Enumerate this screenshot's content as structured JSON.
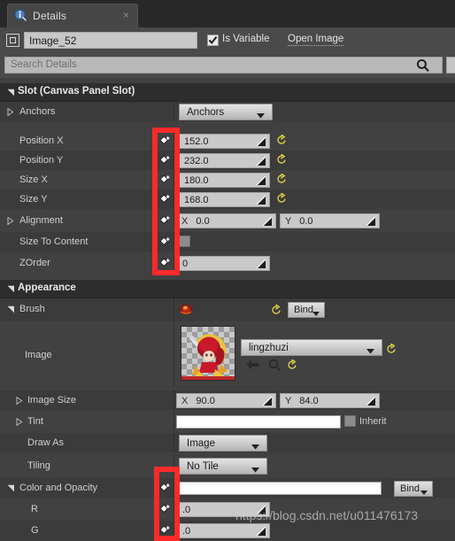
{
  "window": {
    "tab": {
      "label": "Details",
      "icon": "details-info-icon",
      "close_icon": "×"
    }
  },
  "object_row": {
    "icon": "widget-icon",
    "name_value": "Image_52",
    "is_variable_label": "Is Variable",
    "is_variable_checked": true,
    "open_image_link": "Open Image"
  },
  "search": {
    "placeholder": "Search Details",
    "value": "",
    "icon": "search-icon"
  },
  "sections": [
    {
      "title": "Slot (Canvas Panel Slot)",
      "expanded": true,
      "rows": [
        {
          "label": "Anchors",
          "type": "combo",
          "value": "Anchors",
          "expandable": true
        },
        {
          "label": "Position X",
          "type": "num",
          "value": "152.0",
          "reset": true
        },
        {
          "label": "Position Y",
          "type": "num",
          "value": "232.0",
          "reset": true
        },
        {
          "label": "Size X",
          "type": "num",
          "value": "180.0",
          "reset": true
        },
        {
          "label": "Size Y",
          "type": "num",
          "value": "168.0",
          "reset": true
        },
        {
          "label": "Alignment",
          "type": "xy",
          "x_label": "X",
          "x_value": "0.0",
          "y_label": "Y",
          "y_value": "0.0",
          "expandable": true
        },
        {
          "label": "Size To Content",
          "type": "check",
          "checked": false
        },
        {
          "label": "ZOrder",
          "type": "num",
          "value": "0"
        }
      ]
    },
    {
      "title": "Appearance",
      "expanded": true,
      "rows": [
        {
          "label": "Brush",
          "type": "brush-header",
          "bind_label": "Bind",
          "expandable": true
        },
        {
          "label": "Image",
          "type": "asset",
          "asset_name": "lingzhuzi"
        },
        {
          "label": "Image Size",
          "type": "xy",
          "x_label": "X",
          "x_value": "90.0",
          "y_label": "Y",
          "y_value": "84.0",
          "expandable": true
        },
        {
          "label": "Tint",
          "type": "tint",
          "inherit_label": "Inherit",
          "inherit_checked": false,
          "color": "#ffffff",
          "expandable": true
        },
        {
          "label": "Draw As",
          "type": "combo",
          "value": "Image"
        },
        {
          "label": "Tiling",
          "type": "combo",
          "value": "No Tile"
        },
        {
          "label": "Color and Opacity",
          "type": "color-bind",
          "bind_label": "Bind",
          "color": "#ffffff",
          "expandable": true
        },
        {
          "label": "R",
          "type": "num",
          "value": ".0"
        },
        {
          "label": "G",
          "type": "num",
          "value": ".0"
        }
      ]
    }
  ],
  "annotations": {
    "box1_name": "red-highlight-slot-bind-column",
    "box2_name": "red-highlight-color-bind-column",
    "color": "#fb2a2a"
  },
  "watermark": {
    "text": "https://blog.csdn.net/u011476173"
  }
}
